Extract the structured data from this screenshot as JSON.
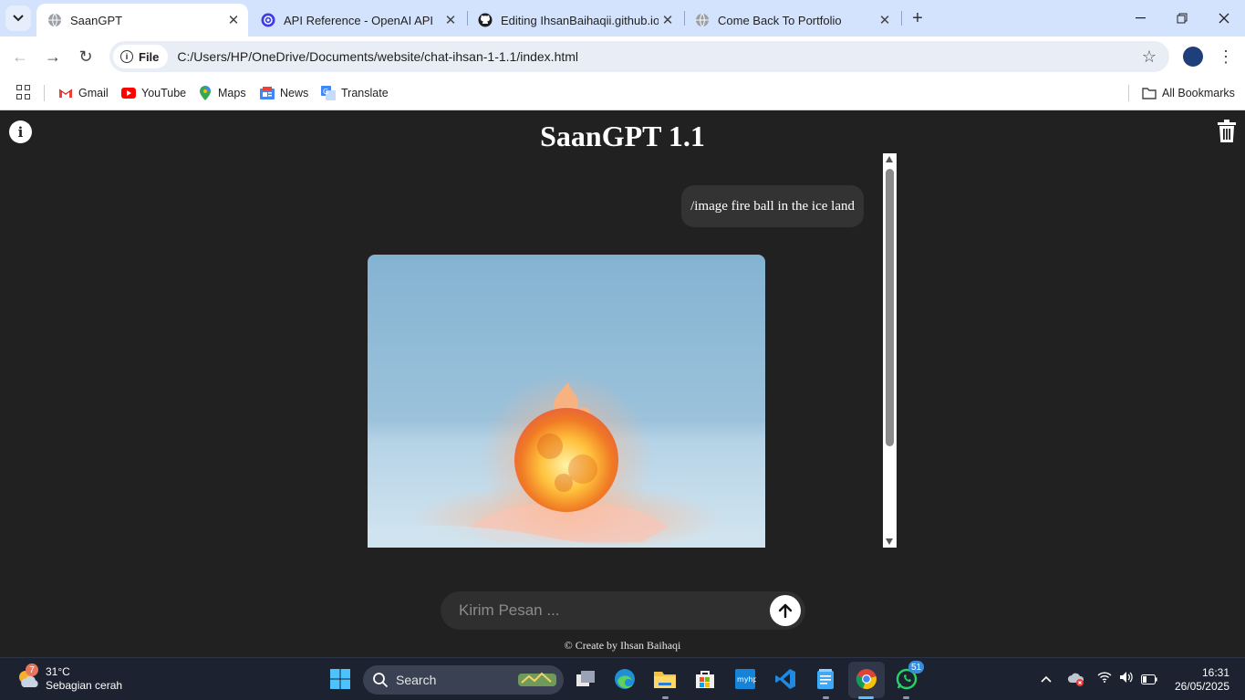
{
  "browser": {
    "tabs": [
      {
        "title": "SaanGPT",
        "active": true
      },
      {
        "title": "API Reference - OpenAI API",
        "active": false
      },
      {
        "title": "Editing IhsanBaihaqii.github.io/",
        "active": false
      },
      {
        "title": "Come Back To Portfolio",
        "active": false
      }
    ],
    "address": {
      "scheme_label": "File",
      "url": "C:/Users/HP/OneDrive/Documents/website/chat-ihsan-1-1.1/index.html"
    },
    "bookmarks": [
      {
        "label": "Gmail",
        "icon": "gmail-icon"
      },
      {
        "label": "YouTube",
        "icon": "youtube-icon"
      },
      {
        "label": "Maps",
        "icon": "maps-icon"
      },
      {
        "label": "News",
        "icon": "news-icon"
      },
      {
        "label": "Translate",
        "icon": "translate-icon"
      }
    ],
    "all_bookmarks_label": "All Bookmarks"
  },
  "app": {
    "title": "SaanGPT 1.1",
    "messages": [
      {
        "role": "user",
        "text": "/image fire ball in the ice land"
      },
      {
        "role": "assistant",
        "type": "image",
        "subject": "fire-ball-in-ice-land"
      }
    ],
    "composer": {
      "placeholder": "Kirim Pesan ...",
      "value": ""
    },
    "footer": "© Create by Ihsan Baihaqi"
  },
  "taskbar": {
    "weather": {
      "temp": "31°C",
      "desc": "Sebagian cerah",
      "badge": "7"
    },
    "search_label": "Search",
    "whatsapp_badge": "51",
    "time": "16:31",
    "date": "26/05/2025"
  },
  "colors": {
    "page_bg": "#212121",
    "bubble_bg": "#333333",
    "composer_bg": "#2f2f2f",
    "tabstrip_bg": "#d3e3fd"
  }
}
